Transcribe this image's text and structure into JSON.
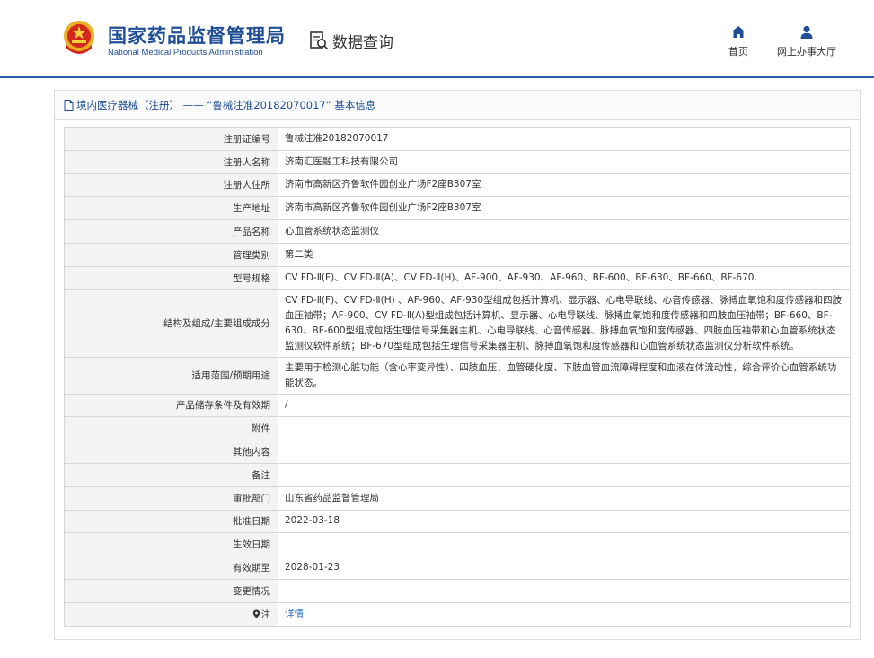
{
  "header": {
    "brand_cn": "国家药品监督管理局",
    "brand_en": "National Medical Products Administration",
    "query_label": "数据查询",
    "nav": {
      "home_label": "首页",
      "hall_label": "网上办事大厅"
    },
    "accent_color": "#1f4e96"
  },
  "panel": {
    "title": "境内医疗器械（注册） —— “鲁械注准20182070017” 基本信息"
  },
  "rows": [
    {
      "label": "注册证编号",
      "value": "鲁械注准20182070017"
    },
    {
      "label": "注册人名称",
      "value": "济南汇医融工科技有限公司"
    },
    {
      "label": "注册人住所",
      "value": "济南市高新区齐鲁软件园创业广场F2座B307室"
    },
    {
      "label": "生产地址",
      "value": "济南市高新区齐鲁软件园创业广场F2座B307室"
    },
    {
      "label": "产品名称",
      "value": "心血管系统状态监测仪"
    },
    {
      "label": "管理类别",
      "value": "第二类"
    },
    {
      "label": "型号规格",
      "value": "CV FD-Ⅱ(F)、CV FD-Ⅱ(A)、CV FD-Ⅱ(H)、AF-900、AF-930、AF-960、BF-600、BF-630、BF-660、BF-670."
    },
    {
      "label": "结构及组成/主要组成成分",
      "value": "CV FD-Ⅱ(F)、CV FD-Ⅱ(H) 、AF-960、AF-930型组成包括计算机、显示器、心电导联线、心音传感器、脉搏血氧饱和度传感器和四肢血压袖带；AF-900、CV FD-Ⅱ(A)型组成包括计算机、显示器、心电导联线、脉搏血氧饱和度传感器和四肢血压袖带；BF-660、BF-630、BF-600型组成包括生理信号采集器主机、心电导联线、心音传感器、脉搏血氧饱和度传感器、四肢血压袖带和心血管系统状态监测仪软件系统；BF-670型组成包括生理信号采集器主机、脉搏血氧饱和度传感器和心血管系统状态监测仪分析软件系统。"
    },
    {
      "label": "适用范围/预期用途",
      "value": "主要用于检测心脏功能（含心率变异性）、四肢血压、血管硬化度、下肢血管血流障碍程度和血液在体流动性，综合评价心血管系统功能状态。"
    },
    {
      "label": "产品储存条件及有效期",
      "value": "/"
    },
    {
      "label": "附件",
      "value": ""
    },
    {
      "label": "其他内容",
      "value": ""
    },
    {
      "label": "备注",
      "value": ""
    },
    {
      "label": "审批部门",
      "value": "山东省药品监督管理局"
    },
    {
      "label": "批准日期",
      "value": "2022-03-18"
    },
    {
      "label": "生效日期",
      "value": ""
    },
    {
      "label": "有效期至",
      "value": "2028-01-23"
    },
    {
      "label": "变更情况",
      "value": ""
    },
    {
      "label": "注",
      "value": "详情"
    }
  ]
}
